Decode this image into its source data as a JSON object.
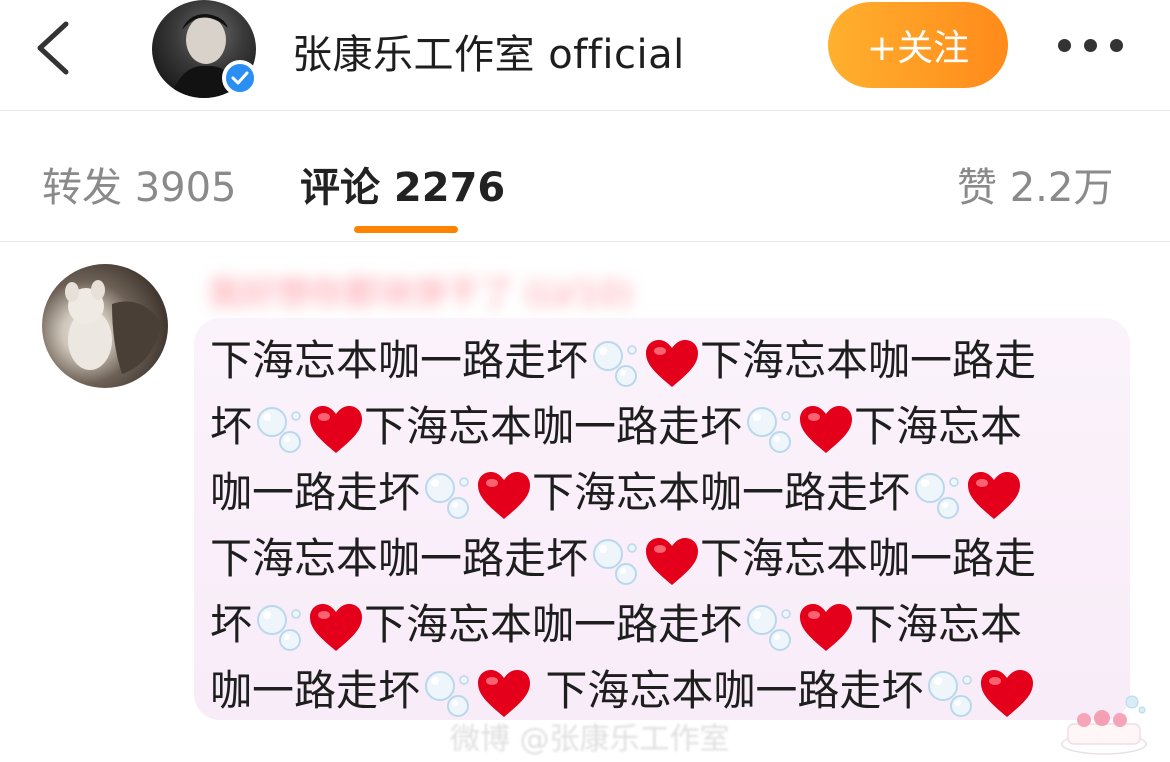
{
  "header": {
    "account_name": "张康乐工作室 official",
    "follow_label": "+关注"
  },
  "tabs": [
    {
      "label": "转发 3905"
    },
    {
      "label": "评论 2276"
    },
    {
      "label": "赞 2.2万"
    }
  ],
  "comment": {
    "commenter_name": "我好想你那块饼干了 (LV10)",
    "text_lines": [
      [
        "下海忘本咖一路走坏",
        "bubble",
        "heart",
        "下海忘本咖一路走"
      ],
      [
        "坏",
        "bubble",
        "heart",
        "下海忘本咖一路走坏",
        "bubble",
        "heart",
        "下海忘本"
      ],
      [
        "咖一路走坏",
        "bubble",
        "heart",
        "下海忘本咖一路走坏",
        "bubble",
        "heart"
      ],
      [
        "下海忘本咖一路走坏",
        "bubble",
        "heart",
        "下海忘本咖一路走"
      ],
      [
        "坏",
        "bubble",
        "heart",
        "下海忘本咖一路走坏",
        "bubble",
        "heart",
        "下海忘本"
      ],
      [
        "咖一路走坏",
        "bubble",
        "heart",
        " 下海忘本咖一路走坏",
        "bubble",
        "heart"
      ]
    ]
  },
  "watermark": "微博 @张康乐工作室"
}
